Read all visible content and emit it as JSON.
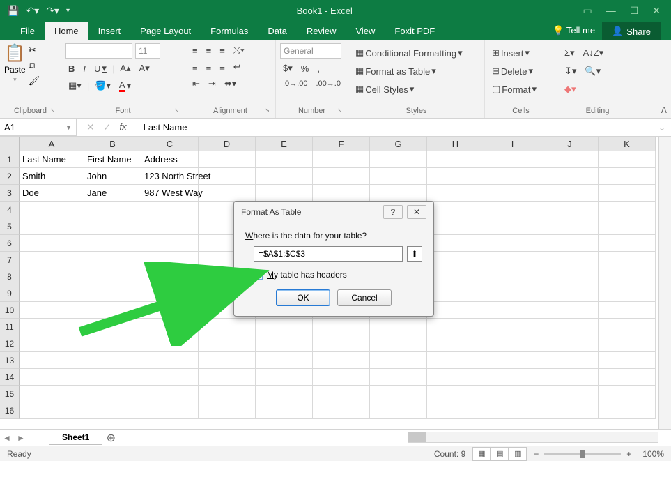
{
  "titlebar": {
    "title": "Book1 - Excel"
  },
  "tabs": {
    "file": "File",
    "home": "Home",
    "insert": "Insert",
    "pagelayout": "Page Layout",
    "formulas": "Formulas",
    "data": "Data",
    "review": "Review",
    "view": "View",
    "foxit": "Foxit PDF",
    "tellme": "Tell me",
    "share": "Share"
  },
  "ribbon": {
    "clipboard": {
      "paste": "Paste",
      "label": "Clipboard"
    },
    "font": {
      "size": "11",
      "label": "Font",
      "bold": "B",
      "italic": "I",
      "underline": "U"
    },
    "alignment": {
      "label": "Alignment"
    },
    "number": {
      "format": "General",
      "label": "Number"
    },
    "styles": {
      "cond": "Conditional Formatting",
      "fmt": "Format as Table",
      "cell": "Cell Styles",
      "label": "Styles"
    },
    "cells": {
      "insert": "Insert",
      "delete": "Delete",
      "format": "Format",
      "label": "Cells"
    },
    "editing": {
      "label": "Editing"
    }
  },
  "namebox": "A1",
  "formula": "Last Name",
  "columns": [
    "A",
    "B",
    "C",
    "D",
    "E",
    "F",
    "G",
    "H",
    "I",
    "J",
    "K"
  ],
  "rows": [
    "1",
    "2",
    "3",
    "4",
    "5",
    "6",
    "7",
    "8",
    "9",
    "10",
    "11",
    "12",
    "13",
    "14",
    "15",
    "16"
  ],
  "data": [
    [
      "Last Name",
      "First Name",
      "Address"
    ],
    [
      "Smith",
      "John",
      "123 North Street"
    ],
    [
      "Doe",
      "Jane",
      "987 West Way"
    ]
  ],
  "sheettab": "Sheet1",
  "dialog": {
    "title": "Format As Table",
    "prompt_pre": "W",
    "prompt_rest": "here is the data for your table?",
    "range": "=$A$1:$C$3",
    "check_pre": "M",
    "check_rest": "y table has headers",
    "ok": "OK",
    "cancel": "Cancel"
  },
  "status": {
    "ready": "Ready",
    "count": "Count: 9",
    "zoom": "100%"
  }
}
